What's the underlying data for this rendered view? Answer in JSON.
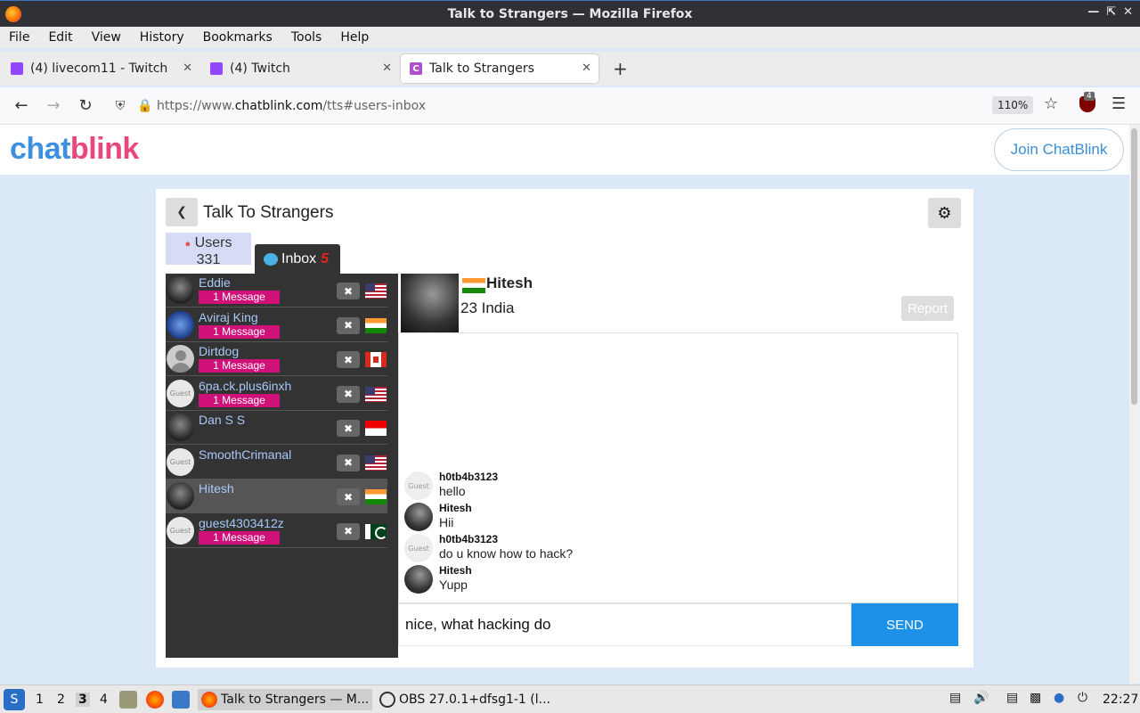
{
  "window": {
    "title": "Talk to Strangers — Mozilla Firefox"
  },
  "menu": [
    "File",
    "Edit",
    "View",
    "History",
    "Bookmarks",
    "Tools",
    "Help"
  ],
  "tabs": [
    {
      "label": "(4) livecom11 - Twitch"
    },
    {
      "label": "(4) Twitch"
    },
    {
      "label": "Talk to Strangers"
    }
  ],
  "nav": {
    "url_prefix": "https://www.",
    "url_domain": "chatblink.com",
    "url_path": "/tts#users-inbox",
    "zoom": "110%",
    "ublock_badge": "4"
  },
  "site": {
    "logo_part1": "chat",
    "logo_part2": "blink",
    "join_label": "Join ChatBlink"
  },
  "card": {
    "title": "Talk To Strangers",
    "users_label": "Users",
    "users_count": "331",
    "inbox_label": "Inbox",
    "inbox_count": "5"
  },
  "users": [
    {
      "name": "Eddie",
      "badge": "1 Message",
      "flag": "us",
      "avatar": "dark"
    },
    {
      "name": "Aviraj King",
      "badge": "1 Message",
      "flag": "in",
      "avatar": "blue"
    },
    {
      "name": "Dirtdog",
      "badge": "1 Message",
      "flag": "ca",
      "avatar": "person"
    },
    {
      "name": "6pa.ck.plus6inxh",
      "badge": "1 Message",
      "flag": "us",
      "avatar": "guest"
    },
    {
      "name": "Dan S S",
      "badge": "",
      "flag": "id",
      "avatar": "dark"
    },
    {
      "name": "SmoothCrimanal",
      "badge": "",
      "flag": "us",
      "avatar": "guest"
    },
    {
      "name": "Hitesh",
      "badge": "",
      "flag": "in",
      "avatar": "dark"
    },
    {
      "name": "guest4303412z",
      "badge": "1 Message",
      "flag": "pk",
      "avatar": "guest"
    }
  ],
  "guest_avatar_text": "Guest",
  "chat": {
    "name": "Hitesh",
    "info": "23 India",
    "report_label": "Report",
    "messages": [
      {
        "author": "h0tb4b3123",
        "text": "hello",
        "avatar": "guest"
      },
      {
        "author": "Hitesh",
        "text": "Hii",
        "avatar": "hitesh"
      },
      {
        "author": "h0tb4b3123",
        "text": "do u know how to hack?",
        "avatar": "guest"
      },
      {
        "author": "Hitesh",
        "text": "Yupp",
        "avatar": "hitesh"
      }
    ],
    "input_value": "nice, what hacking do",
    "send_label": "SEND"
  },
  "taskbar": {
    "workspaces": [
      "1",
      "2",
      "3",
      "4"
    ],
    "tasks": [
      {
        "label": "Talk to Strangers — M..."
      },
      {
        "label": "OBS 27.0.1+dfsg1-1 (l..."
      }
    ],
    "clock": "22:27"
  },
  "colors": {
    "brand_blue": "#3d8fe0",
    "brand_pink": "#e8477e",
    "message_badge": "#d0117a",
    "send_button": "#1e90e8",
    "page_bg": "#dbe8f8"
  }
}
